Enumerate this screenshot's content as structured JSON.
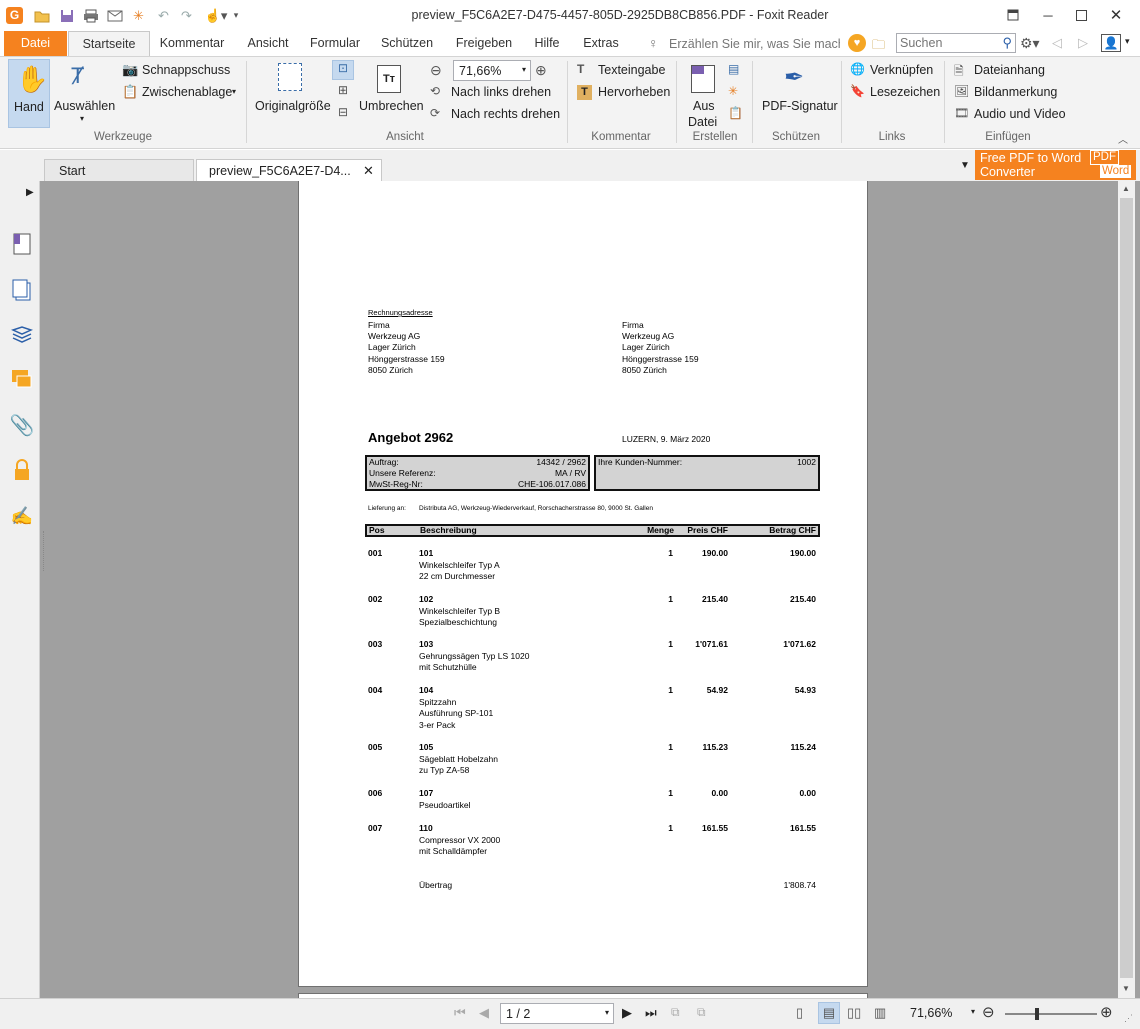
{
  "window": {
    "title": "preview_F5C6A2E7-D475-4457-805D-2925DB8CB856.PDF - Foxit Reader"
  },
  "colors": {
    "accent": "#f5821f",
    "ribbon_bg": "#f3f3f3",
    "workspace": "#a0a0a0",
    "selected": "#c5d9ef"
  },
  "menu": {
    "datei": "Datei",
    "tabs": [
      "Startseite",
      "Kommentar",
      "Ansicht",
      "Formular",
      "Schützen",
      "Freigeben",
      "Hilfe",
      "Extras"
    ],
    "tell_me": "Erzählen Sie mir, was Sie machen",
    "search_placeholder": "Suchen"
  },
  "ribbon": {
    "hand": "Hand",
    "select": "Auswählen",
    "snapshot": "Schnappschuss",
    "clipboard": "Zwischenablage",
    "tools_group": "Werkzeuge",
    "actual_size": "Originalgröße",
    "reflow": "Umbrechen",
    "zoom": "71,66%",
    "rotate_left": "Nach links drehen",
    "rotate_right": "Nach rechts drehen",
    "view_group": "Ansicht",
    "typewriter": "Texteingabe",
    "highlight": "Hervorheben",
    "comment_group": "Kommentar",
    "from_file_1": "Aus",
    "from_file_2": "Datei",
    "create_group": "Erstellen",
    "pdf_sign": "PDF-Signatur",
    "protect_group": "Schützen",
    "link": "Verknüpfen",
    "bookmark": "Lesezeichen",
    "links_group": "Links",
    "attachment": "Dateianhang",
    "image_annot": "Bildanmerkung",
    "audio_video": "Audio und Video",
    "insert_group": "Einfügen"
  },
  "doctabs": {
    "start": "Start",
    "preview": "preview_F5C6A2E7-D4...",
    "promo_line1": "Free PDF to Word",
    "promo_line2": "Converter",
    "promo_badge1": "PDF",
    "promo_badge2": "Word"
  },
  "document": {
    "billing_label": "Rechnungsadresse",
    "billing": [
      "Firma",
      "Werkzeug AG",
      "Lager Zürich",
      "Hönggerstrasse 159",
      "8050 Zürich"
    ],
    "shipping": [
      "Firma",
      "Werkzeug AG",
      "Lager Zürich",
      "Hönggerstrasse 159",
      "8050 Zürich"
    ],
    "title": "Angebot 2962",
    "place_date": "LUZERN, 9. März 2020",
    "info_left": [
      {
        "label": "Auftrag:",
        "value": "14342 / 2962"
      },
      {
        "label": "Unsere Referenz:",
        "value": "MA / RV"
      },
      {
        "label": "MwSt-Reg-Nr:",
        "value": "CHE-106.017.086"
      }
    ],
    "info_right_label": "Ihre Kunden-Nummer:",
    "info_right_value": "1002",
    "delivery_label": "Lieferung an:",
    "delivery_value": "Distributa AG, Werkzeug-Wiederverkauf, Rorschacherstrasse 80, 9000 St. Gallen",
    "table_headers": {
      "pos": "Pos",
      "desc": "Beschreibung",
      "qty": "Menge",
      "price": "Preis CHF",
      "amount": "Betrag CHF"
    },
    "items": [
      {
        "pos": "001",
        "code": "101",
        "lines": [
          "Winkelschleifer Typ A",
          "22 cm Durchmesser"
        ],
        "qty": "1",
        "price": "190.00",
        "amount": "190.00"
      },
      {
        "pos": "002",
        "code": "102",
        "lines": [
          "Winkelschleifer Typ B",
          "Spezialbeschichtung"
        ],
        "qty": "1",
        "price": "215.40",
        "amount": "215.40"
      },
      {
        "pos": "003",
        "code": "103",
        "lines": [
          "Gehrungssägen Typ LS 1020",
          "mit Schutzhülle"
        ],
        "qty": "1",
        "price": "1'071.61",
        "amount": "1'071.62"
      },
      {
        "pos": "004",
        "code": "104",
        "lines": [
          "Spitzzahn",
          "Ausführung SP-101",
          "3-er Pack"
        ],
        "qty": "1",
        "price": "54.92",
        "amount": "54.93"
      },
      {
        "pos": "005",
        "code": "105",
        "lines": [
          "Sägeblatt Hobelzahn",
          "zu Typ ZA-58"
        ],
        "qty": "1",
        "price": "115.23",
        "amount": "115.24"
      },
      {
        "pos": "006",
        "code": "107",
        "lines": [
          "Pseudoartikel"
        ],
        "qty": "1",
        "price": "0.00",
        "amount": "0.00"
      },
      {
        "pos": "007",
        "code": "110",
        "lines": [
          "Compressor VX 2000",
          "mit Schalldämpfer"
        ],
        "qty": "1",
        "price": "161.55",
        "amount": "161.55"
      }
    ],
    "carry_label": "Übertrag",
    "carry_value": "1'808.74"
  },
  "statusbar": {
    "page": "1 / 2",
    "zoom": "71,66%",
    "zoom_slider_fraction": 0.35
  }
}
